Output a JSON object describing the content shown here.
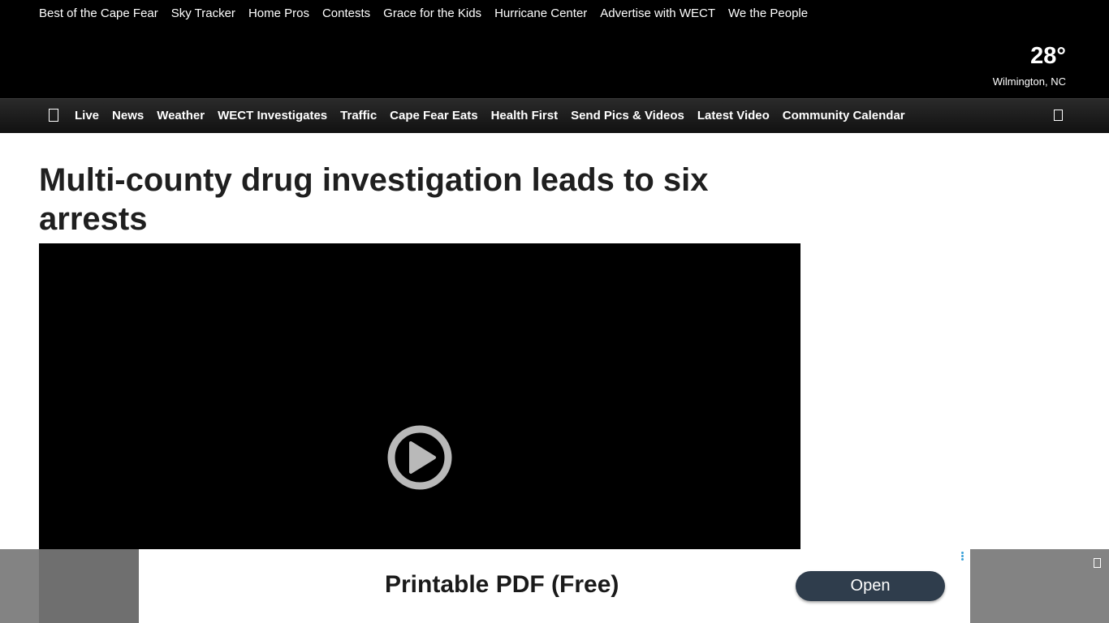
{
  "top_links": [
    "Best of the Cape Fear",
    "Sky Tracker",
    "Home Pros",
    "Contests",
    "Grace for the Kids",
    "Hurricane Center",
    "Advertise with WECT",
    "We the People"
  ],
  "weather": {
    "temperature": "28°",
    "location": "Wilmington, NC"
  },
  "nav": {
    "items": [
      "Live",
      "News",
      "Weather",
      "WECT Investigates",
      "Traffic",
      "Cape Fear Eats",
      "Health First",
      "Send Pics & Videos",
      "Latest Video",
      "Community Calendar"
    ],
    "menu_icon": "menu-icon",
    "search_icon": "search-icon"
  },
  "article": {
    "headline": "Multi-county drug investigation leads to six arrests"
  },
  "video": {
    "play_icon": "play-icon"
  },
  "ad": {
    "title": "Printable PDF (Free)",
    "button_label": "Open",
    "close_icon": "close-icon"
  },
  "colors": {
    "topbar": "#000000",
    "navbar": "#1a1a1a",
    "ad_button": "#2f3d4c"
  }
}
